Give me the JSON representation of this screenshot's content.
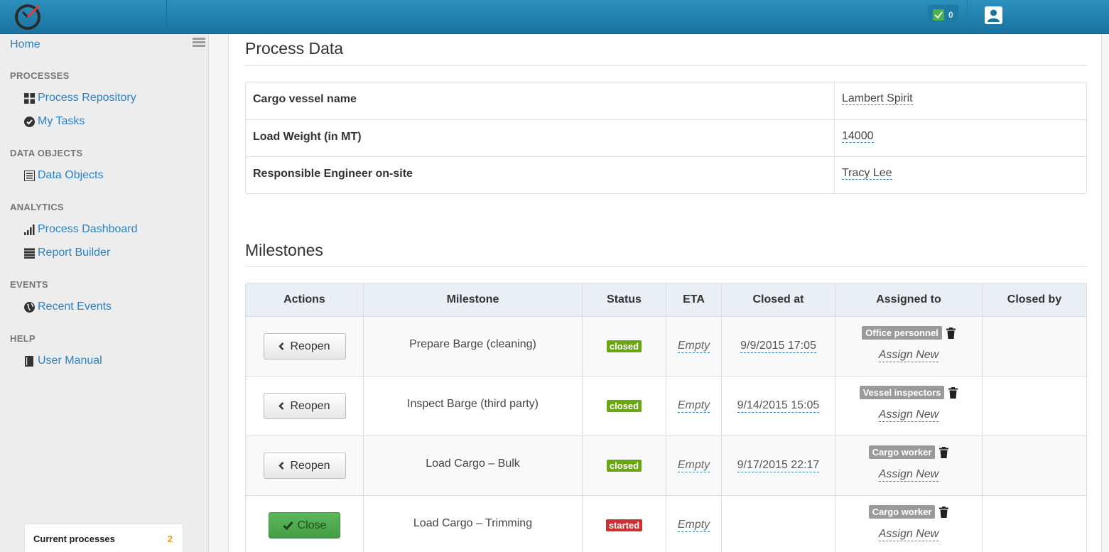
{
  "topbar": {
    "logo_icon": "clock-logo-icon",
    "tasks_count": "0",
    "user_icon": "user-icon"
  },
  "sidebar": {
    "home": "Home",
    "sections": [
      {
        "title": "PROCESSES",
        "items": [
          {
            "label": "Process Repository",
            "icon": "grid-icon"
          },
          {
            "label": "My Tasks",
            "icon": "check-circle-icon"
          }
        ]
      },
      {
        "title": "DATA OBJECTS",
        "items": [
          {
            "label": "Data Objects",
            "icon": "list-icon"
          }
        ]
      },
      {
        "title": "ANALYTICS",
        "items": [
          {
            "label": "Process Dashboard",
            "icon": "bar-chart-icon"
          },
          {
            "label": "Report Builder",
            "icon": "table-icon"
          }
        ]
      },
      {
        "title": "EVENTS",
        "items": [
          {
            "label": "Recent Events",
            "icon": "globe-icon"
          }
        ]
      },
      {
        "title": "HELP",
        "items": [
          {
            "label": "User Manual",
            "icon": "book-icon"
          }
        ]
      }
    ],
    "current_processes": {
      "label": "Current processes",
      "count": "2"
    }
  },
  "process_data": {
    "title": "Process Data",
    "rows": [
      {
        "key": "Cargo vessel name",
        "value": "Lambert Spirit"
      },
      {
        "key": "Load Weight (in MT)",
        "value": "14000"
      },
      {
        "key": "Responsible Engineer on-site",
        "value": "Tracy Lee"
      }
    ]
  },
  "milestones": {
    "title": "Milestones",
    "headers": [
      "Actions",
      "Milestone",
      "Status",
      "ETA",
      "Closed at",
      "Assigned to",
      "Closed by"
    ],
    "rows": [
      {
        "action": "Reopen",
        "milestone": "Prepare Barge (cleaning)",
        "status": "closed",
        "eta": "Empty",
        "closed_at": "9/9/2015 17:05",
        "assignee": "Office personnel",
        "assign_new": "Assign New",
        "closed_by": ""
      },
      {
        "action": "Reopen",
        "milestone": "Inspect Barge (third party)",
        "status": "closed",
        "eta": "Empty",
        "closed_at": "9/14/2015 15:05",
        "assignee": "Vessel inspectors",
        "assign_new": "Assign New",
        "closed_by": ""
      },
      {
        "action": "Reopen",
        "milestone": "Load Cargo – Bulk",
        "status": "closed",
        "eta": "Empty",
        "closed_at": "9/17/2015 22:17",
        "assignee": "Cargo worker",
        "assign_new": "Assign New",
        "closed_by": ""
      },
      {
        "action": "Close",
        "milestone": "Load Cargo – Trimming",
        "status": "started",
        "eta": "Empty",
        "closed_at": "",
        "assignee": "Cargo worker",
        "assign_new": "Assign New",
        "closed_by": ""
      }
    ]
  },
  "colors": {
    "topbar": "#1f80ae",
    "link": "#2a82c4",
    "status_closed": "#6aa512",
    "status_started": "#d02f2f",
    "close_button": "#5cb85c"
  }
}
